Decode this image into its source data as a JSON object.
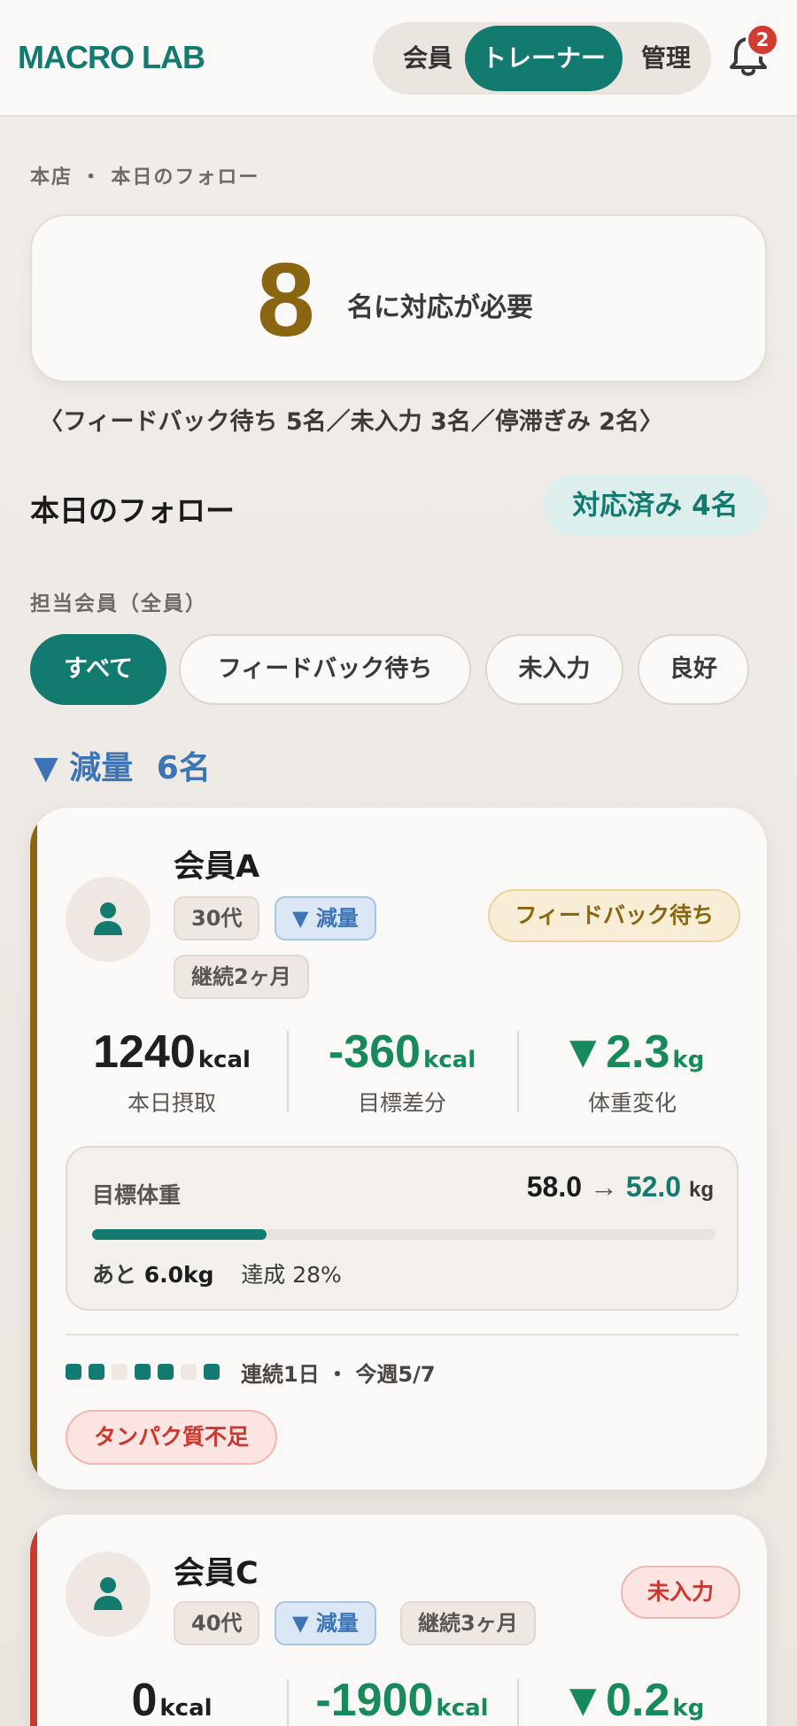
{
  "app": {
    "logo": "MACRO LAB"
  },
  "header": {
    "roles": [
      "会員",
      "トレーナー",
      "管理"
    ],
    "notification_count": "2"
  },
  "summary": {
    "breadcrumb": "本店 ・ 本日のフォロー",
    "count": "8",
    "count_label": "名に対応が必要",
    "breakdown": "〈フィードバック待ち 5名／未入力 3名／停滞ぎみ 2名〉"
  },
  "section": {
    "title": "本日のフォロー",
    "done_label": "対応済み 4名"
  },
  "filters": {
    "label": "担当会員（全員）",
    "chips": [
      "すべて",
      "フィードバック待ち",
      "未入力",
      "良好"
    ]
  },
  "group": {
    "label": "▼ 減量",
    "count": "6名"
  },
  "members": [
    {
      "name": "会員A",
      "tags": [
        "30代",
        "▼ 減量",
        "継続2ヶ月"
      ],
      "status": "フィードバック待ち",
      "status_color": "#8a6512",
      "stats": [
        {
          "value": "1240",
          "unit": "kcal",
          "label": "本日摂取"
        },
        {
          "value": "-360",
          "unit": "kcal",
          "label": "目標差分"
        },
        {
          "value": "▼2.3",
          "unit": "kg",
          "label": "体重変化"
        }
      ],
      "goal": {
        "label": "目標体重",
        "from": "58.0",
        "arrow": "→",
        "to": "52.0",
        "unit": "kg",
        "progress": 0.28,
        "remain_prefix": "あと",
        "remain_value": "6.0kg",
        "achieve": "達成 28%"
      },
      "streak_days": [
        true,
        true,
        false,
        true,
        true,
        false,
        true
      ],
      "streak_text": "連続1日 ・ 今週5/7",
      "warning": "タンパク質不足"
    },
    {
      "name": "会員C",
      "tags": [
        "40代",
        "▼ 減量",
        "継続3ヶ月"
      ],
      "status": "未入力",
      "status_color": "#c9392d",
      "stats": [
        {
          "value": "0",
          "unit": "kcal",
          "label": ""
        },
        {
          "value": "-1900",
          "unit": "kcal",
          "label": ""
        },
        {
          "value": "▼0.2",
          "unit": "kg",
          "label": ""
        }
      ]
    }
  ],
  "colors": {
    "accent": "#137a6f",
    "wait": "#8a6512",
    "alert": "#c9392d",
    "goal": "#3c74b5"
  }
}
